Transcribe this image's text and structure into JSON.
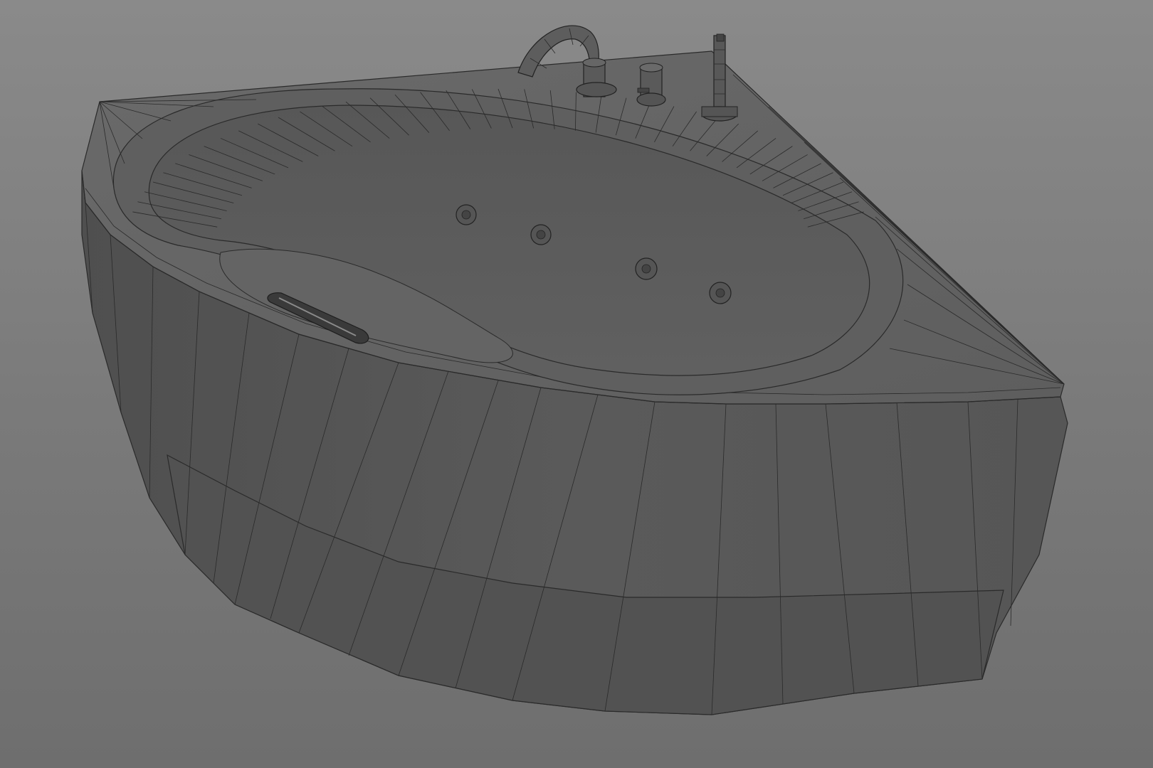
{
  "viewport": {
    "background_top": "#8a8a8a",
    "background_bottom": "#6e6e6e",
    "view": "perspective"
  },
  "model": {
    "object": "corner-whirlpool-bathtub",
    "display": "wireframe-on-shaded",
    "surface_color": "#5b5b5b",
    "rim_color": "#636363",
    "wire_color": "#2a2a2a",
    "jets_visible": 4,
    "fixtures": [
      "spout",
      "mixer-knob",
      "hand-shower"
    ],
    "headrest": "drain-handle"
  }
}
